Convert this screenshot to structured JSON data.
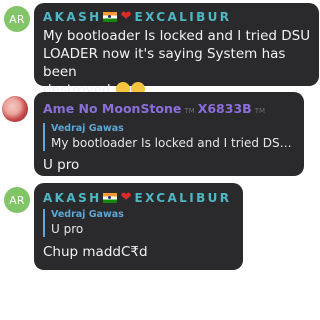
{
  "colors": {
    "bubble_bg": "#2a2a2c",
    "accent_cyan": "#4fb6c4",
    "accent_purple": "#8b6fd9",
    "reply_blue": "#5da6d6",
    "avatar_green": "#82c468"
  },
  "messages": [
    {
      "avatar_initials": "AR",
      "sender_prefix": "AKASH",
      "sender_suffix": "EXCALIBUR",
      "text_lines": [
        "My bootloader Is locked and I tried DSU",
        "LOADER now it's saying System has been",
        "destroyed"
      ],
      "emojis": [
        "pleading-face-emoji",
        "pleading-face-emoji"
      ]
    },
    {
      "sender_name": "Ame No MoonStone",
      "sender_tm": "TM",
      "sender_tag": "X6833B",
      "sender_tag_tm": "TM",
      "reply_name": "Vedraj Gawas",
      "reply_text": "My bootloader Is locked and I tried DSU L...",
      "text": "U pro"
    },
    {
      "avatar_initials": "AR",
      "sender_prefix": "AKASH",
      "sender_suffix": "EXCALIBUR",
      "reply_name": "Vedraj Gawas",
      "reply_text": "U pro",
      "text": "Chup maddC₹d"
    }
  ]
}
